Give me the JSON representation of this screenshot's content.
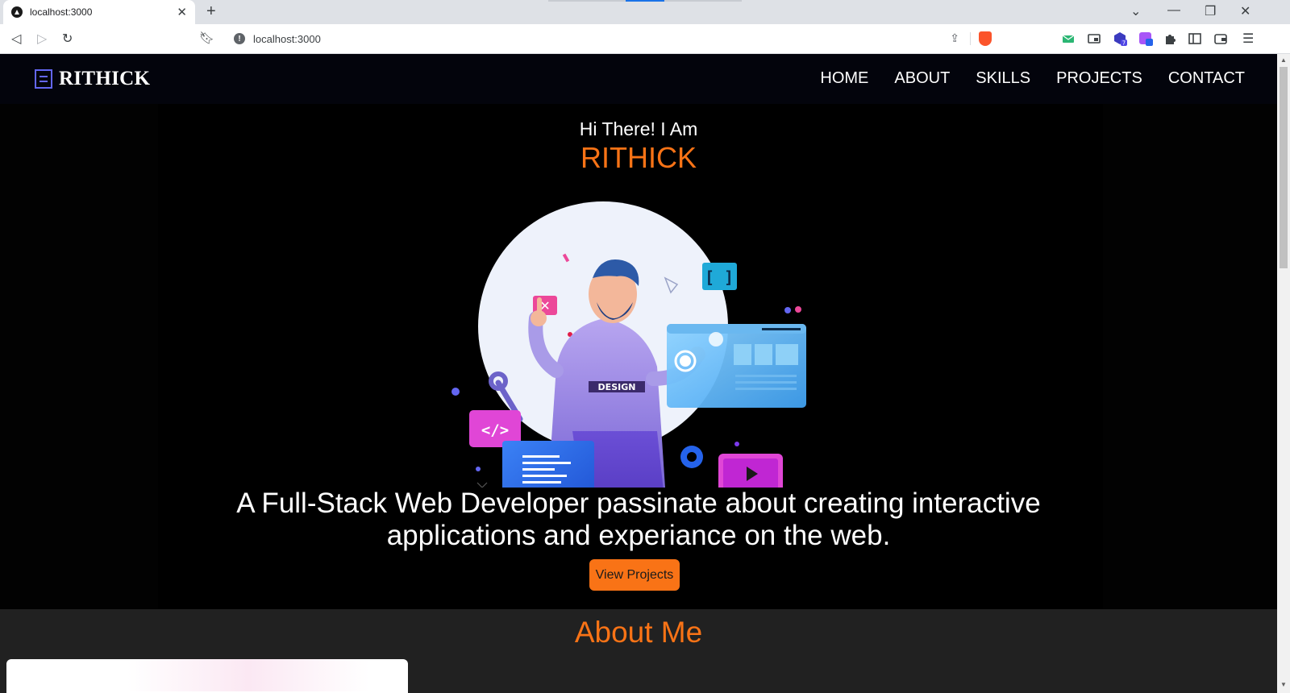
{
  "browser": {
    "tab_title": "localhost:3000",
    "url": "localhost:3000"
  },
  "site": {
    "logo_text": "RITHICK",
    "nav": [
      "HOME",
      "ABOUT",
      "SKILLS",
      "PROJECTS",
      "CONTACT"
    ]
  },
  "hero": {
    "greeting": "Hi There! I Am",
    "name": "RITHICK",
    "illustration_badge": "DESIGN",
    "tagline_line1": "A Full-Stack Web Developer passinate about creating interactive",
    "tagline_line2": "applications and experiance on the web.",
    "cta_label": "View Projects"
  },
  "about": {
    "title": "About Me"
  },
  "colors": {
    "accent": "#f97316",
    "logo_icon": "#6366f1",
    "page_bg": "#000000",
    "about_bg": "#212121"
  }
}
